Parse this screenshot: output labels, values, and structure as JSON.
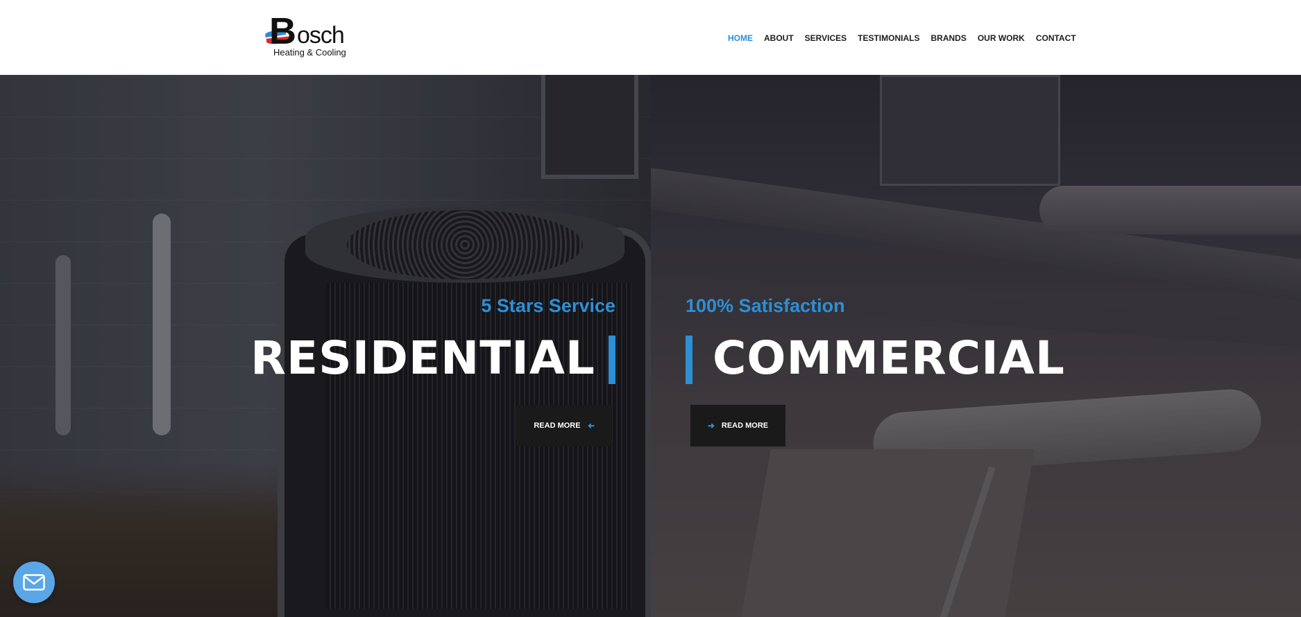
{
  "brand": {
    "logo_main_initial": "B",
    "logo_main_rest": "osch",
    "logo_subtitle": "Heating & Cooling",
    "colors": {
      "accent": "#2d8fd5",
      "logo_red": "#d62b2b",
      "logo_blue": "#2f8ad6"
    }
  },
  "nav": {
    "items": [
      {
        "label": "HOME",
        "active": true
      },
      {
        "label": "ABOUT",
        "active": false
      },
      {
        "label": "SERVICES",
        "active": false
      },
      {
        "label": "TESTIMONIALS",
        "active": false
      },
      {
        "label": "BRANDS",
        "active": false
      },
      {
        "label": "OUR WORK",
        "active": false
      },
      {
        "label": "CONTACT",
        "active": false
      }
    ]
  },
  "hero": {
    "left": {
      "tagline": "5 Stars Service",
      "heading": "RESIDENTIAL",
      "button_label": "READ MORE",
      "button_icon": "arrow-left-icon"
    },
    "right": {
      "tagline": "100% Satisfaction",
      "heading": "COMMERCIAL",
      "button_label": "READ MORE",
      "button_icon": "arrow-right-icon"
    }
  },
  "floating": {
    "mail_icon": "mail-icon"
  }
}
